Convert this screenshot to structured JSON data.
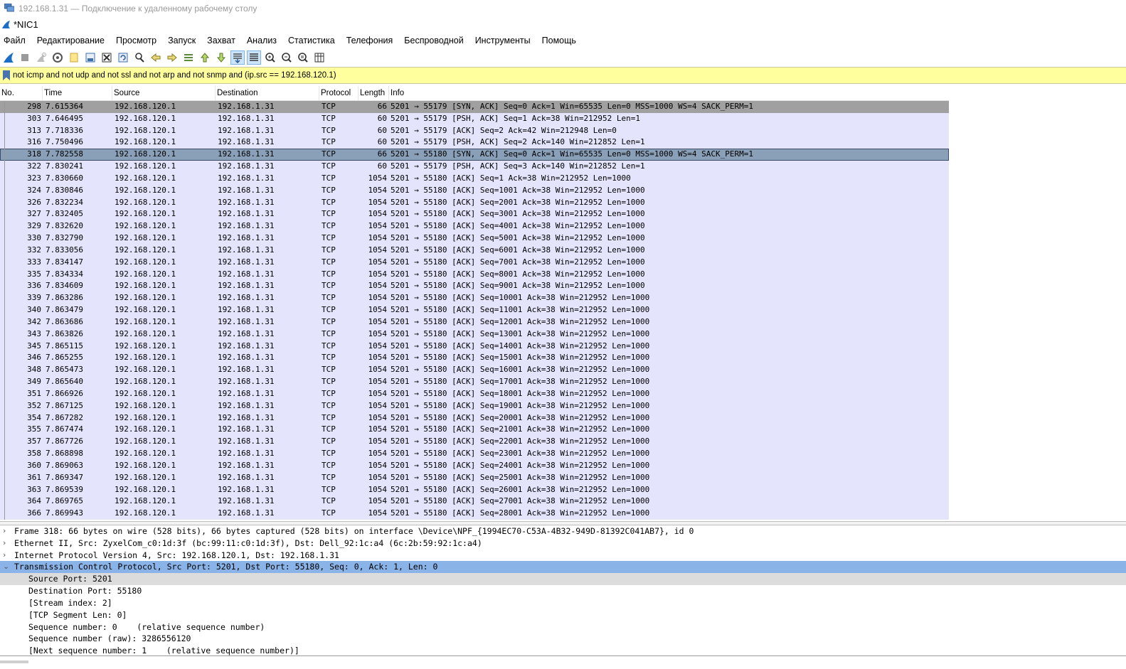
{
  "rdp": {
    "title": "192.168.1.31 — Подключение к удаленному рабочему столу",
    "icon": "remote-desktop-icon"
  },
  "app": {
    "title": "*NIC1",
    "icon": "wireshark-fin-icon"
  },
  "menu": [
    "Файл",
    "Редактирование",
    "Просмотр",
    "Запуск",
    "Захват",
    "Анализ",
    "Статистика",
    "Телефония",
    "Беспроводной",
    "Инструменты",
    "Помощь"
  ],
  "toolbar": {
    "icons": [
      "start-capture-icon",
      "stop-capture-icon",
      "restart-capture-icon",
      "capture-options-icon",
      "open-file-icon",
      "save-file-icon",
      "close-file-icon",
      "reload-file-icon",
      "find-packet-icon",
      "go-back-icon",
      "go-forward-icon",
      "go-to-packet-icon",
      "go-first-icon",
      "go-last-icon",
      "autoscroll-icon",
      "colorize-icon",
      "zoom-in-icon",
      "zoom-out-icon",
      "normal-size-icon",
      "resize-columns-icon"
    ]
  },
  "filter": {
    "value": "not icmp and not udp and not ssl and not arp and not snmp and (ip.src == 192.168.120.1)"
  },
  "columns": [
    "No.",
    "Time",
    "Source",
    "Destination",
    "Protocol",
    "Length",
    "Info"
  ],
  "packets": [
    {
      "no": "298",
      "time": "7.615364",
      "src": "192.168.120.1",
      "dst": "192.168.1.31",
      "proto": "TCP",
      "len": "66",
      "info": "5201 → 55179 [SYN, ACK] Seq=0 Ack=1 Win=65535 Len=0 MSS=1000 WS=4 SACK_PERM=1"
    },
    {
      "no": "303",
      "time": "7.646495",
      "src": "192.168.120.1",
      "dst": "192.168.1.31",
      "proto": "TCP",
      "len": "60",
      "info": "5201 → 55179 [PSH, ACK] Seq=1 Ack=38 Win=212952 Len=1"
    },
    {
      "no": "313",
      "time": "7.718336",
      "src": "192.168.120.1",
      "dst": "192.168.1.31",
      "proto": "TCP",
      "len": "60",
      "info": "5201 → 55179 [ACK] Seq=2 Ack=42 Win=212948 Len=0"
    },
    {
      "no": "316",
      "time": "7.750496",
      "src": "192.168.120.1",
      "dst": "192.168.1.31",
      "proto": "TCP",
      "len": "60",
      "info": "5201 → 55179 [PSH, ACK] Seq=2 Ack=140 Win=212852 Len=1"
    },
    {
      "no": "318",
      "time": "7.782558",
      "src": "192.168.120.1",
      "dst": "192.168.1.31",
      "proto": "TCP",
      "len": "66",
      "info": "5201 → 55180 [SYN, ACK] Seq=0 Ack=1 Win=65535 Len=0 MSS=1000 WS=4 SACK_PERM=1"
    },
    {
      "no": "322",
      "time": "7.830241",
      "src": "192.168.120.1",
      "dst": "192.168.1.31",
      "proto": "TCP",
      "len": "60",
      "info": "5201 → 55179 [PSH, ACK] Seq=3 Ack=140 Win=212852 Len=1"
    },
    {
      "no": "323",
      "time": "7.830660",
      "src": "192.168.120.1",
      "dst": "192.168.1.31",
      "proto": "TCP",
      "len": "1054",
      "info": "5201 → 55180 [ACK] Seq=1 Ack=38 Win=212952 Len=1000"
    },
    {
      "no": "324",
      "time": "7.830846",
      "src": "192.168.120.1",
      "dst": "192.168.1.31",
      "proto": "TCP",
      "len": "1054",
      "info": "5201 → 55180 [ACK] Seq=1001 Ack=38 Win=212952 Len=1000"
    },
    {
      "no": "326",
      "time": "7.832234",
      "src": "192.168.120.1",
      "dst": "192.168.1.31",
      "proto": "TCP",
      "len": "1054",
      "info": "5201 → 55180 [ACK] Seq=2001 Ack=38 Win=212952 Len=1000"
    },
    {
      "no": "327",
      "time": "7.832405",
      "src": "192.168.120.1",
      "dst": "192.168.1.31",
      "proto": "TCP",
      "len": "1054",
      "info": "5201 → 55180 [ACK] Seq=3001 Ack=38 Win=212952 Len=1000"
    },
    {
      "no": "329",
      "time": "7.832620",
      "src": "192.168.120.1",
      "dst": "192.168.1.31",
      "proto": "TCP",
      "len": "1054",
      "info": "5201 → 55180 [ACK] Seq=4001 Ack=38 Win=212952 Len=1000"
    },
    {
      "no": "330",
      "time": "7.832790",
      "src": "192.168.120.1",
      "dst": "192.168.1.31",
      "proto": "TCP",
      "len": "1054",
      "info": "5201 → 55180 [ACK] Seq=5001 Ack=38 Win=212952 Len=1000"
    },
    {
      "no": "332",
      "time": "7.833056",
      "src": "192.168.120.1",
      "dst": "192.168.1.31",
      "proto": "TCP",
      "len": "1054",
      "info": "5201 → 55180 [ACK] Seq=6001 Ack=38 Win=212952 Len=1000"
    },
    {
      "no": "333",
      "time": "7.834147",
      "src": "192.168.120.1",
      "dst": "192.168.1.31",
      "proto": "TCP",
      "len": "1054",
      "info": "5201 → 55180 [ACK] Seq=7001 Ack=38 Win=212952 Len=1000"
    },
    {
      "no": "335",
      "time": "7.834334",
      "src": "192.168.120.1",
      "dst": "192.168.1.31",
      "proto": "TCP",
      "len": "1054",
      "info": "5201 → 55180 [ACK] Seq=8001 Ack=38 Win=212952 Len=1000"
    },
    {
      "no": "336",
      "time": "7.834609",
      "src": "192.168.120.1",
      "dst": "192.168.1.31",
      "proto": "TCP",
      "len": "1054",
      "info": "5201 → 55180 [ACK] Seq=9001 Ack=38 Win=212952 Len=1000"
    },
    {
      "no": "339",
      "time": "7.863286",
      "src": "192.168.120.1",
      "dst": "192.168.1.31",
      "proto": "TCP",
      "len": "1054",
      "info": "5201 → 55180 [ACK] Seq=10001 Ack=38 Win=212952 Len=1000"
    },
    {
      "no": "340",
      "time": "7.863479",
      "src": "192.168.120.1",
      "dst": "192.168.1.31",
      "proto": "TCP",
      "len": "1054",
      "info": "5201 → 55180 [ACK] Seq=11001 Ack=38 Win=212952 Len=1000"
    },
    {
      "no": "342",
      "time": "7.863686",
      "src": "192.168.120.1",
      "dst": "192.168.1.31",
      "proto": "TCP",
      "len": "1054",
      "info": "5201 → 55180 [ACK] Seq=12001 Ack=38 Win=212952 Len=1000"
    },
    {
      "no": "343",
      "time": "7.863826",
      "src": "192.168.120.1",
      "dst": "192.168.1.31",
      "proto": "TCP",
      "len": "1054",
      "info": "5201 → 55180 [ACK] Seq=13001 Ack=38 Win=212952 Len=1000"
    },
    {
      "no": "345",
      "time": "7.865115",
      "src": "192.168.120.1",
      "dst": "192.168.1.31",
      "proto": "TCP",
      "len": "1054",
      "info": "5201 → 55180 [ACK] Seq=14001 Ack=38 Win=212952 Len=1000"
    },
    {
      "no": "346",
      "time": "7.865255",
      "src": "192.168.120.1",
      "dst": "192.168.1.31",
      "proto": "TCP",
      "len": "1054",
      "info": "5201 → 55180 [ACK] Seq=15001 Ack=38 Win=212952 Len=1000"
    },
    {
      "no": "348",
      "time": "7.865473",
      "src": "192.168.120.1",
      "dst": "192.168.1.31",
      "proto": "TCP",
      "len": "1054",
      "info": "5201 → 55180 [ACK] Seq=16001 Ack=38 Win=212952 Len=1000"
    },
    {
      "no": "349",
      "time": "7.865640",
      "src": "192.168.120.1",
      "dst": "192.168.1.31",
      "proto": "TCP",
      "len": "1054",
      "info": "5201 → 55180 [ACK] Seq=17001 Ack=38 Win=212952 Len=1000"
    },
    {
      "no": "351",
      "time": "7.866926",
      "src": "192.168.120.1",
      "dst": "192.168.1.31",
      "proto": "TCP",
      "len": "1054",
      "info": "5201 → 55180 [ACK] Seq=18001 Ack=38 Win=212952 Len=1000"
    },
    {
      "no": "352",
      "time": "7.867125",
      "src": "192.168.120.1",
      "dst": "192.168.1.31",
      "proto": "TCP",
      "len": "1054",
      "info": "5201 → 55180 [ACK] Seq=19001 Ack=38 Win=212952 Len=1000"
    },
    {
      "no": "354",
      "time": "7.867282",
      "src": "192.168.120.1",
      "dst": "192.168.1.31",
      "proto": "TCP",
      "len": "1054",
      "info": "5201 → 55180 [ACK] Seq=20001 Ack=38 Win=212952 Len=1000"
    },
    {
      "no": "355",
      "time": "7.867474",
      "src": "192.168.120.1",
      "dst": "192.168.1.31",
      "proto": "TCP",
      "len": "1054",
      "info": "5201 → 55180 [ACK] Seq=21001 Ack=38 Win=212952 Len=1000"
    },
    {
      "no": "357",
      "time": "7.867726",
      "src": "192.168.120.1",
      "dst": "192.168.1.31",
      "proto": "TCP",
      "len": "1054",
      "info": "5201 → 55180 [ACK] Seq=22001 Ack=38 Win=212952 Len=1000"
    },
    {
      "no": "358",
      "time": "7.868898",
      "src": "192.168.120.1",
      "dst": "192.168.1.31",
      "proto": "TCP",
      "len": "1054",
      "info": "5201 → 55180 [ACK] Seq=23001 Ack=38 Win=212952 Len=1000"
    },
    {
      "no": "360",
      "time": "7.869063",
      "src": "192.168.120.1",
      "dst": "192.168.1.31",
      "proto": "TCP",
      "len": "1054",
      "info": "5201 → 55180 [ACK] Seq=24001 Ack=38 Win=212952 Len=1000"
    },
    {
      "no": "361",
      "time": "7.869347",
      "src": "192.168.120.1",
      "dst": "192.168.1.31",
      "proto": "TCP",
      "len": "1054",
      "info": "5201 → 55180 [ACK] Seq=25001 Ack=38 Win=212952 Len=1000"
    },
    {
      "no": "363",
      "time": "7.869539",
      "src": "192.168.120.1",
      "dst": "192.168.1.31",
      "proto": "TCP",
      "len": "1054",
      "info": "5201 → 55180 [ACK] Seq=26001 Ack=38 Win=212952 Len=1000"
    },
    {
      "no": "364",
      "time": "7.869765",
      "src": "192.168.120.1",
      "dst": "192.168.1.31",
      "proto": "TCP",
      "len": "1054",
      "info": "5201 → 55180 [ACK] Seq=27001 Ack=38 Win=212952 Len=1000"
    },
    {
      "no": "366",
      "time": "7.869943",
      "src": "192.168.120.1",
      "dst": "192.168.1.31",
      "proto": "TCP",
      "len": "1054",
      "info": "5201 → 55180 [ACK] Seq=28001 Ack=38 Win=212952 Len=1000"
    }
  ],
  "details": [
    {
      "text": "Frame 318: 66 bytes on wire (528 bits), 66 bytes captured (528 bits) on interface \\Device\\NPF_{1994EC70-C53A-4B32-949D-81392C041AB7}, id 0",
      "expanded": false
    },
    {
      "text": "Ethernet II, Src: ZyxelCom_c0:1d:3f (bc:99:11:c0:1d:3f), Dst: Dell_92:1c:a4 (6c:2b:59:92:1c:a4)",
      "expanded": false
    },
    {
      "text": "Internet Protocol Version 4, Src: 192.168.120.1, Dst: 192.168.1.31",
      "expanded": false
    },
    {
      "text": "Transmission Control Protocol, Src Port: 5201, Dst Port: 55180, Seq: 0, Ack: 1, Len: 0",
      "expanded": true
    }
  ],
  "tcp_fields": [
    "Source Port: 5201",
    "Destination Port: 55180",
    "[Stream index: 2]",
    "[TCP Segment Len: 0]",
    "Sequence number: 0    (relative sequence number)",
    "Sequence number (raw): 3286556120",
    "[Next sequence number: 1    (relative sequence number)]"
  ],
  "colors": {
    "row_bg": "#e4e4fc",
    "selected": "#8a9fb8",
    "filter_bg": "#ffff9e",
    "detail_highlight": "#8ab4e8"
  }
}
